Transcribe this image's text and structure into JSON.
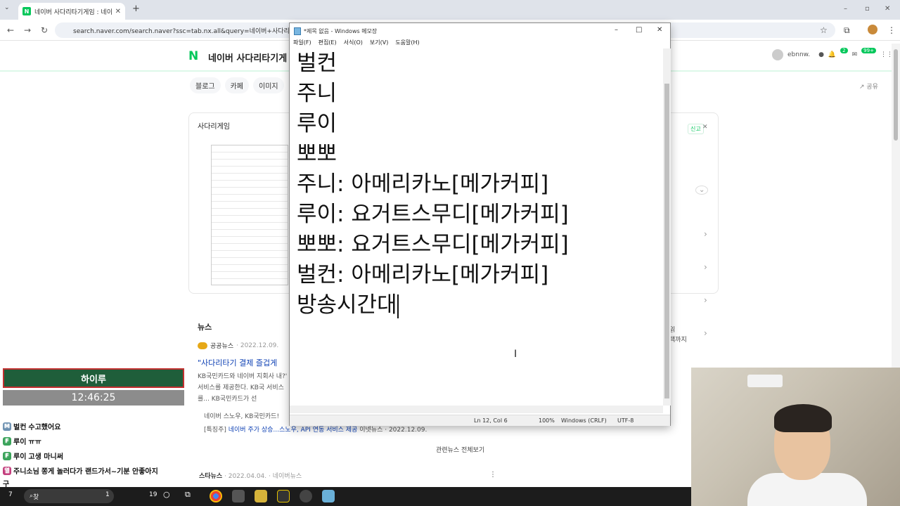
{
  "browser": {
    "tab_title": "네이버 사다리타기게임 : 네이버",
    "url": "search.naver.com/search.naver?ssc=tab.nx.all&query=네이버+사다리타기게임"
  },
  "naver": {
    "logo": "N",
    "title": "네이버 사다리타기게",
    "user": "ebnnw.",
    "badge_mail": "2",
    "badge_alert": "99+",
    "filters": [
      "블로그",
      "카페",
      "이미지"
    ],
    "share": "공유",
    "card_title": "사다리게임",
    "report": "신고",
    "side_text_1": "읽",
    "side_text_2": "택까지",
    "news_heading": "뉴스",
    "news_source": "공공뉴스",
    "news_date": "2022.12.09.",
    "news_title": "\"사다리타기 결제 즐겁게",
    "news_body": "KB국민카드와 네이버 지회사 내?' 서비스를 제공한다. KB국 서비스를... KB국민카드가 선",
    "related_1": "네이버 스노우, KB국민카드!",
    "related_2_tag": "[특징주]",
    "related_2_title": "네이버 주가 상승...스노우, API 연동 서비스 제공",
    "related_2_src": "이넷뉴스",
    "related_2_date": "2022.12.09.",
    "related_more": "관련뉴스 전체보기",
    "news2_source": "스타뉴스",
    "news2_date": "2022.04.04.",
    "news2_via": "네이버뉴스"
  },
  "notepad": {
    "title": "*제목 없음 - Windows 메모장",
    "menu": [
      "파일(F)",
      "편집(E)",
      "서식(O)",
      "보기(V)",
      "도움말(H)"
    ],
    "lines": [
      "벌컨",
      "주니",
      "루이",
      "뽀뽀",
      "",
      "주니: 아메리카노[메가커피]",
      "루이: 요거트스무디[메가커피]",
      "뽀뽀: 요거트스무디[메가커피]",
      "벌컨: 아메리카노[메가커피]",
      "",
      "방송시간대"
    ],
    "status_pos": "Ln 12, Col 6",
    "status_zoom": "100%",
    "status_eol": "Windows (CRLF)",
    "status_enc": "UTF-8"
  },
  "overlay": {
    "name": "하이루",
    "time": "12:46:25",
    "chat": [
      {
        "badge": "M",
        "color": "#6a8fb0",
        "user": "벌컨",
        "msg": "수고했어요"
      },
      {
        "badge": "F",
        "color": "#3aa35a",
        "user": "루이",
        "msg": "ㅠㅠ"
      },
      {
        "badge": "F",
        "color": "#3aa35a",
        "user": "루이",
        "msg": "고생 마니써"
      },
      {
        "badge": "열",
        "color": "#c23a7a",
        "user": "주니소님",
        "msg": "쫑게 놀러다가 랜드가서~기분 안좋아지"
      }
    ],
    "chat_tail": "구"
  },
  "taskbar": {
    "search": "찾",
    "count_a": "1",
    "count_b": "1",
    "count_c": "19",
    "left_num": "7"
  }
}
